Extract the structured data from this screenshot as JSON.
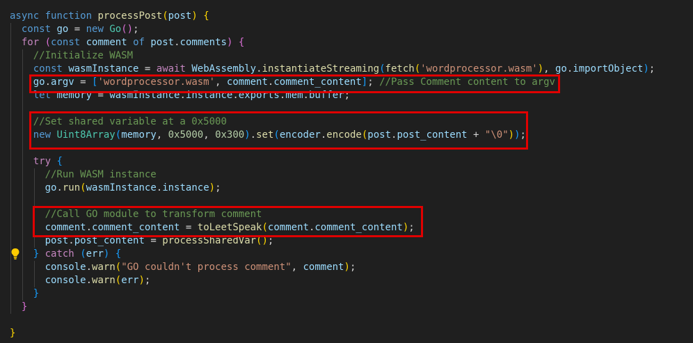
{
  "code": {
    "lines": [
      [
        [
          "kw",
          "async"
        ],
        [
          "plain",
          " "
        ],
        [
          "kw",
          "function"
        ],
        [
          "plain",
          " "
        ],
        [
          "fn",
          "processPost"
        ],
        [
          "b1",
          "("
        ],
        [
          "var",
          "post"
        ],
        [
          "b1",
          ")"
        ],
        [
          "plain",
          " "
        ],
        [
          "b1",
          "{"
        ]
      ],
      [
        [
          "plain",
          "  "
        ],
        [
          "kw",
          "const"
        ],
        [
          "plain",
          " "
        ],
        [
          "var",
          "go"
        ],
        [
          "plain",
          " = "
        ],
        [
          "kw",
          "new"
        ],
        [
          "plain",
          " "
        ],
        [
          "cls",
          "Go"
        ],
        [
          "b2",
          "()"
        ],
        [
          "plain",
          ";"
        ]
      ],
      [
        [
          "plain",
          "  "
        ],
        [
          "ctl",
          "for"
        ],
        [
          "plain",
          " "
        ],
        [
          "b2",
          "("
        ],
        [
          "kw",
          "const"
        ],
        [
          "plain",
          " "
        ],
        [
          "var",
          "comment"
        ],
        [
          "plain",
          " "
        ],
        [
          "kw",
          "of"
        ],
        [
          "plain",
          " "
        ],
        [
          "var",
          "post"
        ],
        [
          "plain",
          "."
        ],
        [
          "var",
          "comments"
        ],
        [
          "b2",
          ")"
        ],
        [
          "plain",
          " "
        ],
        [
          "b2",
          "{"
        ]
      ],
      [
        [
          "plain",
          "    "
        ],
        [
          "com",
          "//Initialize WASM"
        ]
      ],
      [
        [
          "plain",
          "    "
        ],
        [
          "kw",
          "const"
        ],
        [
          "plain",
          " "
        ],
        [
          "var",
          "wasmInstance"
        ],
        [
          "plain",
          " = "
        ],
        [
          "ctl",
          "await"
        ],
        [
          "plain",
          " "
        ],
        [
          "var",
          "WebAssembly"
        ],
        [
          "plain",
          "."
        ],
        [
          "fn",
          "instantiateStreaming"
        ],
        [
          "b3",
          "("
        ],
        [
          "fn",
          "fetch"
        ],
        [
          "b1",
          "("
        ],
        [
          "str",
          "'wordprocessor.wasm'"
        ],
        [
          "b1",
          ")"
        ],
        [
          "plain",
          ", "
        ],
        [
          "var",
          "go"
        ],
        [
          "plain",
          "."
        ],
        [
          "var",
          "importObject"
        ],
        [
          "b3",
          ")"
        ],
        [
          "plain",
          ";"
        ]
      ],
      [
        [
          "plain",
          "    "
        ],
        [
          "var",
          "go"
        ],
        [
          "plain",
          "."
        ],
        [
          "var",
          "argv"
        ],
        [
          "plain",
          " = "
        ],
        [
          "b3",
          "["
        ],
        [
          "str",
          "'wordprocessor.wasm'"
        ],
        [
          "plain",
          ", "
        ],
        [
          "var",
          "comment"
        ],
        [
          "plain",
          "."
        ],
        [
          "var",
          "comment_content"
        ],
        [
          "b3",
          "]"
        ],
        [
          "plain",
          "; "
        ],
        [
          "com",
          "//Pass Comment content to argv"
        ]
      ],
      [
        [
          "plain",
          "    "
        ],
        [
          "kw",
          "let"
        ],
        [
          "plain",
          " "
        ],
        [
          "var",
          "memory"
        ],
        [
          "plain",
          " = "
        ],
        [
          "var",
          "wasmInstance"
        ],
        [
          "plain",
          "."
        ],
        [
          "var",
          "instance"
        ],
        [
          "plain",
          "."
        ],
        [
          "var",
          "exports"
        ],
        [
          "plain",
          "."
        ],
        [
          "var",
          "mem"
        ],
        [
          "plain",
          "."
        ],
        [
          "var",
          "buffer"
        ],
        [
          "plain",
          ";"
        ]
      ],
      [
        [
          "plain",
          ""
        ]
      ],
      [
        [
          "plain",
          "    "
        ],
        [
          "com",
          "//Set shared variable at a 0x5000"
        ]
      ],
      [
        [
          "plain",
          "    "
        ],
        [
          "kw",
          "new"
        ],
        [
          "plain",
          " "
        ],
        [
          "cls",
          "Uint8Array"
        ],
        [
          "b3",
          "("
        ],
        [
          "var",
          "memory"
        ],
        [
          "plain",
          ", "
        ],
        [
          "num",
          "0x5000"
        ],
        [
          "plain",
          ", "
        ],
        [
          "num",
          "0x300"
        ],
        [
          "b3",
          ")"
        ],
        [
          "plain",
          "."
        ],
        [
          "fn",
          "set"
        ],
        [
          "b3",
          "("
        ],
        [
          "var",
          "encoder"
        ],
        [
          "plain",
          "."
        ],
        [
          "fn",
          "encode"
        ],
        [
          "b1",
          "("
        ],
        [
          "var",
          "post"
        ],
        [
          "plain",
          "."
        ],
        [
          "var",
          "post_content"
        ],
        [
          "plain",
          " + "
        ],
        [
          "str",
          "\"\\0\""
        ],
        [
          "b1",
          ")"
        ],
        [
          "b3",
          ")"
        ],
        [
          "plain",
          ";"
        ]
      ],
      [
        [
          "plain",
          ""
        ]
      ],
      [
        [
          "plain",
          "    "
        ],
        [
          "ctl",
          "try"
        ],
        [
          "plain",
          " "
        ],
        [
          "b3",
          "{"
        ]
      ],
      [
        [
          "plain",
          "      "
        ],
        [
          "com",
          "//Run WASM instance"
        ]
      ],
      [
        [
          "plain",
          "      "
        ],
        [
          "var",
          "go"
        ],
        [
          "plain",
          "."
        ],
        [
          "fn",
          "run"
        ],
        [
          "b1",
          "("
        ],
        [
          "var",
          "wasmInstance"
        ],
        [
          "plain",
          "."
        ],
        [
          "var",
          "instance"
        ],
        [
          "b1",
          ")"
        ],
        [
          "plain",
          ";"
        ]
      ],
      [
        [
          "plain",
          ""
        ]
      ],
      [
        [
          "plain",
          "      "
        ],
        [
          "com",
          "//Call GO module to transform comment"
        ]
      ],
      [
        [
          "plain",
          "      "
        ],
        [
          "var",
          "comment"
        ],
        [
          "plain",
          "."
        ],
        [
          "var",
          "comment_content"
        ],
        [
          "plain",
          " = "
        ],
        [
          "fn",
          "toLeetSpeak"
        ],
        [
          "b1",
          "("
        ],
        [
          "var",
          "comment"
        ],
        [
          "plain",
          "."
        ],
        [
          "var",
          "comment_content"
        ],
        [
          "b1",
          ")"
        ],
        [
          "plain",
          ";"
        ]
      ],
      [
        [
          "plain",
          "      "
        ],
        [
          "var",
          "post"
        ],
        [
          "plain",
          "."
        ],
        [
          "var",
          "post_content"
        ],
        [
          "plain",
          " = "
        ],
        [
          "fn",
          "processSharedVar"
        ],
        [
          "b1",
          "()"
        ],
        [
          "plain",
          ";"
        ]
      ],
      [
        [
          "plain",
          "    "
        ],
        [
          "b3",
          "}"
        ],
        [
          "plain",
          " "
        ],
        [
          "ctl",
          "catch"
        ],
        [
          "plain",
          " "
        ],
        [
          "b3",
          "("
        ],
        [
          "var",
          "err"
        ],
        [
          "b3",
          ")"
        ],
        [
          "plain",
          " "
        ],
        [
          "b3",
          "{"
        ]
      ],
      [
        [
          "plain",
          "      "
        ],
        [
          "var",
          "console"
        ],
        [
          "plain",
          "."
        ],
        [
          "fn",
          "warn"
        ],
        [
          "b1",
          "("
        ],
        [
          "str",
          "\"GO couldn't process comment\""
        ],
        [
          "plain",
          ", "
        ],
        [
          "var",
          "comment"
        ],
        [
          "b1",
          ")"
        ],
        [
          "plain",
          ";"
        ]
      ],
      [
        [
          "plain",
          "      "
        ],
        [
          "var",
          "console"
        ],
        [
          "plain",
          "."
        ],
        [
          "fn",
          "warn"
        ],
        [
          "b1",
          "("
        ],
        [
          "var",
          "err"
        ],
        [
          "b1",
          ")"
        ],
        [
          "plain",
          ";"
        ]
      ],
      [
        [
          "plain",
          "    "
        ],
        [
          "b3",
          "}"
        ]
      ],
      [
        [
          "plain",
          "  "
        ],
        [
          "b2",
          "}"
        ]
      ],
      [
        [
          "plain",
          ""
        ]
      ],
      [
        [
          "b1",
          "}"
        ]
      ]
    ]
  },
  "colors": {
    "background": "#1f1f1f",
    "highlight_border": "#e00000",
    "lightbulb": "#ffcc00"
  },
  "icons": {
    "lightbulb": "lightbulb-icon"
  }
}
